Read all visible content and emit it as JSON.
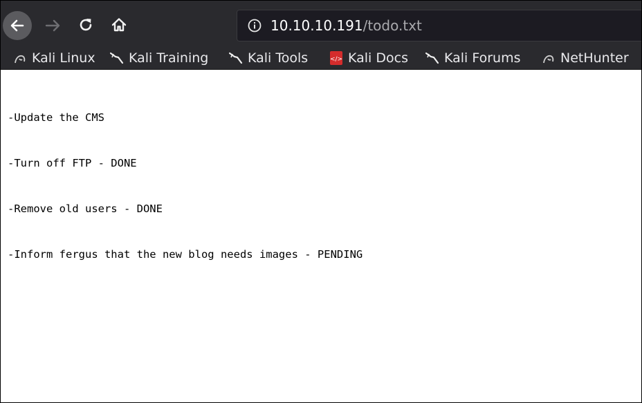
{
  "toolbar": {
    "url_host": "10.10.10.191",
    "url_path": "/todo.txt",
    "back_icon": "arrow-left-icon",
    "forward_icon": "arrow-right-icon",
    "reload_icon": "reload-icon",
    "home_icon": "home-icon",
    "info_icon": "info-icon"
  },
  "bookmarks": [
    {
      "label": "Kali Linux",
      "icon": "kali-dragon-icon"
    },
    {
      "label": "Kali Training",
      "icon": "kali-dragon-icon"
    },
    {
      "label": "Kali Tools",
      "icon": "kali-dragon-icon"
    },
    {
      "label": "Kali Docs",
      "icon": "docs-icon"
    },
    {
      "label": "Kali Forums",
      "icon": "kali-dragon-icon"
    },
    {
      "label": "NetHunter",
      "icon": "nethunter-icon"
    }
  ],
  "document": {
    "lines": [
      "-Update the CMS",
      "-Turn off FTP - DONE",
      "-Remove old users - DONE",
      "-Inform fergus that the new blog needs images - PENDING"
    ]
  },
  "colors": {
    "toolbar_bg": "#2a2a2e",
    "urlbar_bg": "#1c1b22",
    "docs_icon_red": "#d42c2c"
  }
}
